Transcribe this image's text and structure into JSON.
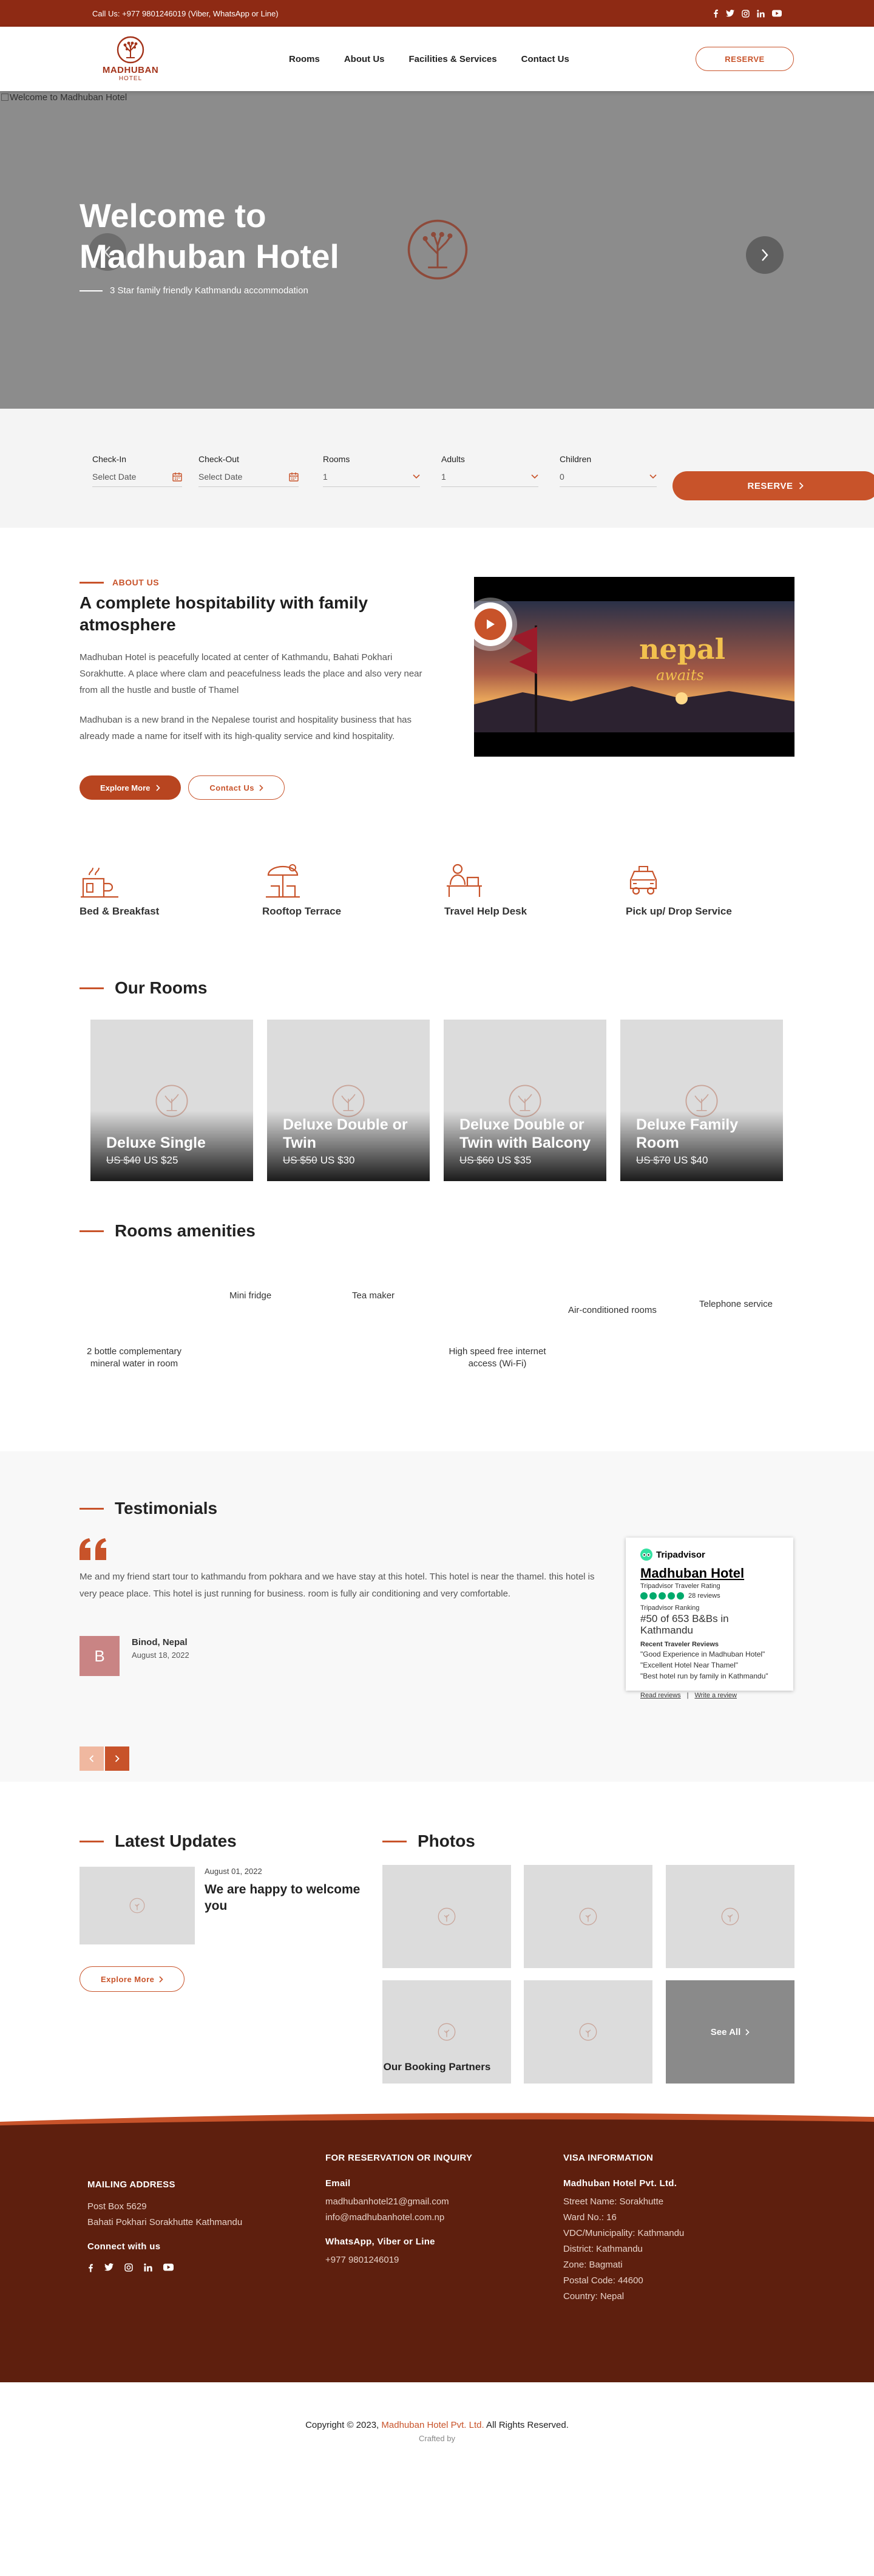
{
  "topbar": {
    "contact": "Call Us: +977 9801246019 (Viber, WhatsApp or Line)",
    "social_icons": [
      "facebook-icon",
      "twitter-icon",
      "instagram-icon",
      "linkedin-icon",
      "youtube-icon"
    ]
  },
  "logo": {
    "name": "MADHUBAN",
    "sub": "HOTEL"
  },
  "nav": {
    "items": [
      "Rooms",
      "About Us",
      "Facilities & Services",
      "Contact Us"
    ],
    "reserve": "RESERVE"
  },
  "hero": {
    "img_alt": "Welcome to Madhuban Hotel",
    "title": "Welcome to Madhuban Hotel",
    "subtitle": "3 Star family friendly Kathmandu accommodation"
  },
  "booking": {
    "checkin_label": "Check-In",
    "checkin_placeholder": "Select Date",
    "checkout_label": "Check-Out",
    "checkout_placeholder": "Select Date",
    "rooms_label": "Rooms",
    "rooms_value": "1",
    "adults_label": "Adults",
    "adults_value": "1",
    "children_label": "Children",
    "children_value": "0",
    "reserve": "RESERVE"
  },
  "about": {
    "eyebrow": "ABOUT US",
    "title": "A complete hospitability with family atmosphere",
    "p1": "Madhuban Hotel is peacefully located at center of Kathmandu, Bahati Pokhari Sorakhutte. A place where clam and peacefulness leads the place and also very near from all the hustle and bustle of Thamel",
    "p2": "Madhuban is a new brand in the Nepalese tourist and hospitality business that has already made a name for itself with its high-quality service and kind hospitality.",
    "explore": "Explore More",
    "contact": "Contact Us",
    "video": {
      "word1": "nepal",
      "word2": "awaits"
    }
  },
  "services": [
    "Bed & Breakfast",
    "Rooftop Terrace",
    "Travel Help Desk",
    "Pick up/ Drop Service"
  ],
  "rooms": {
    "heading": "Our Rooms",
    "items": [
      {
        "name": "Deluxe Single",
        "old": "US $40",
        "price": "US $25"
      },
      {
        "name": "Deluxe Double or Twin",
        "old": "US $50",
        "price": "US $30"
      },
      {
        "name": "Deluxe Double or Twin with Balcony",
        "old": "US $60",
        "price": "US $35"
      },
      {
        "name": "Deluxe Family Room",
        "old": "US $70",
        "price": "US $40"
      }
    ]
  },
  "amenities": {
    "heading": "Rooms amenities",
    "items": [
      "Mini fridge",
      "Tea maker",
      "Air-conditioned rooms",
      "Telephone service",
      "2 bottle complementary mineral water in room",
      "High speed free internet access (Wi-Fi)"
    ]
  },
  "testimonials": {
    "heading": "Testimonials",
    "text": "Me and my friend start tour to kathmandu from pokhara and we have stay at this hotel. This hotel is near the thamel. this hotel is very peace place. This hotel is just running for business. room is fully air conditioning and very comfortable.",
    "initial": "B",
    "name": "Binod, Nepal",
    "date": "August 18, 2022"
  },
  "tripadvisor": {
    "brand": "Tripadvisor",
    "hotel": "Madhuban Hotel",
    "rating_label": "Tripadvisor Traveler Rating",
    "rating": 5,
    "reviews": "28 reviews",
    "ranking_label": "Tripadvisor Ranking",
    "ranking": "#50 of 653 B&Bs in Kathmandu",
    "recent_label": "Recent Traveler Reviews",
    "quotes": [
      "\"Good Experience in Madhuban Hotel\"",
      "\"Excellent Hotel Near Thamel\"",
      "\"Best hotel run by family in Kathmandu\""
    ],
    "read": "Read reviews",
    "write": "Write a review"
  },
  "updates": {
    "heading": "Latest Updates",
    "post_date": "August 01, 2022",
    "post_title": "We are happy to welcome you",
    "explore": "Explore More"
  },
  "photos": {
    "heading": "Photos",
    "see_all": "See All"
  },
  "partners": {
    "heading": "Our Booking Partners"
  },
  "footer": {
    "mailing_heading": "MAILING ADDRESS",
    "po_box": "Post Box 5629",
    "address": "Bahati Pokhari Sorakhutte Kathmandu",
    "connect": "Connect with us",
    "reservation_heading": "FOR RESERVATION OR INQUIRY",
    "email_label": "Email",
    "email1": "madhubanhotel21@gmail.com",
    "email2": "info@madhubanhotel.com.np",
    "whatsapp_label": "WhatsApp, Viber or Line",
    "phone": "+977 9801246019",
    "visa_heading": "VISA INFORMATION",
    "company": "Madhuban Hotel Pvt. Ltd.",
    "visa_lines": [
      "Street Name: Sorakhutte",
      "Ward No.: 16",
      "VDC/Municipality: Kathmandu",
      "District: Kathmandu",
      "Zone: Bagmati",
      "Postal Code: 44600",
      "Country: Nepal"
    ]
  },
  "copyright": {
    "prefix": "Copyright © 2023,",
    "brand": "Madhuban Hotel Pvt. Ltd.",
    "suffix": "All Rights Reserved.",
    "crafted": "Crafted by"
  },
  "colors": {
    "brand": "#c8532a",
    "topbar": "#8e2a14",
    "footer": "#5e1f0e"
  }
}
